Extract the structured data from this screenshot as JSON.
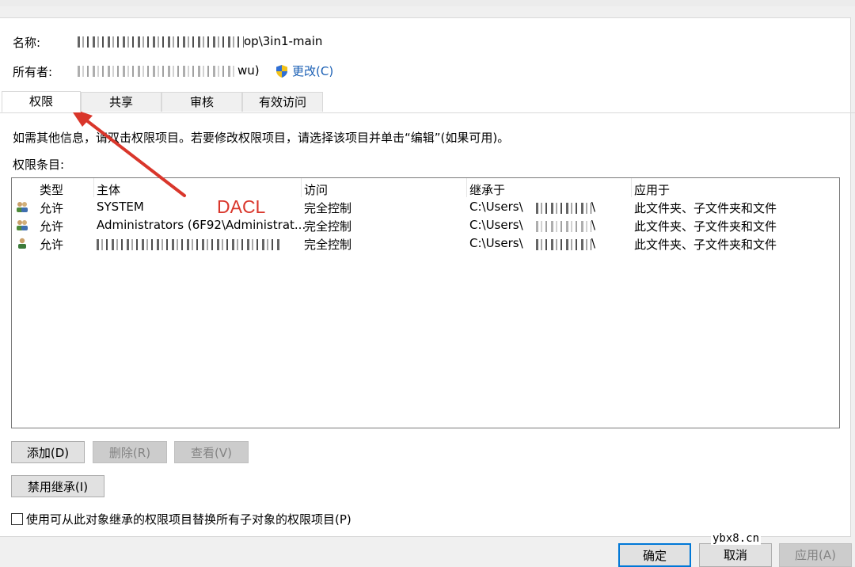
{
  "header": {
    "name_label": "名称:",
    "name_value_visible": "op\\3in1-main",
    "owner_label": "所有者:",
    "owner_value_visible": "wu)",
    "change_owner_link": "更改(C)"
  },
  "tabs": [
    {
      "label": "权限",
      "active": true
    },
    {
      "label": "共享",
      "active": false
    },
    {
      "label": "审核",
      "active": false
    },
    {
      "label": "有效访问",
      "active": false
    }
  ],
  "info_text": "如需其他信息，请双击权限项目。若要修改权限项目，请选择该项目并单击“编辑”(如果可用)。",
  "entries_label": "权限条目:",
  "table": {
    "columns": [
      "类型",
      "主体",
      "访问",
      "继承于",
      "应用于"
    ],
    "rows": [
      {
        "icon": "group-users-icon",
        "type": "允许",
        "principal": "SYSTEM",
        "access": "完全控制",
        "inherited": "C:\\Users\\",
        "inherited_tail": "\\",
        "applies": "此文件夹、子文件夹和文件"
      },
      {
        "icon": "group-users-icon",
        "type": "允许",
        "principal": "Administrators (6F92\\Administrat...",
        "access": "完全控制",
        "inherited": "C:\\Users\\",
        "inherited_tail": "\\",
        "applies": "此文件夹、子文件夹和文件"
      },
      {
        "icon": "single-user-icon",
        "type": "允许",
        "principal": "",
        "access": "完全控制",
        "inherited": "C:\\Users\\",
        "inherited_tail": "\\",
        "applies": "此文件夹、子文件夹和文件"
      }
    ]
  },
  "buttons": {
    "add": "添加(D)",
    "remove": "删除(R)",
    "view": "查看(V)",
    "disable_inheritance": "禁用继承(I)",
    "ok": "确定",
    "cancel": "取消",
    "apply": "应用(A)"
  },
  "replace_checkbox_label": "使用可从此对象继承的权限项目替换所有子对象的权限项目(P)",
  "annotation": {
    "text": "DACL",
    "color": "#d9362b"
  },
  "watermark": "ybx8.cn",
  "colors": {
    "link": "#1a5fb4",
    "primary_border": "#0078d7"
  }
}
